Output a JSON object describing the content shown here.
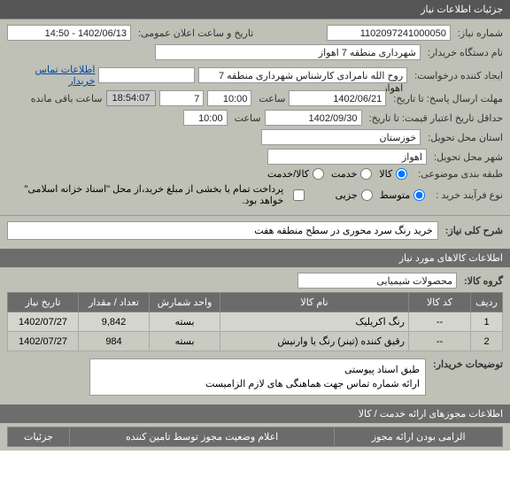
{
  "header": {
    "title": "جزئیات اطلاعات نیاز"
  },
  "fields": {
    "req_no_label": "شماره نیاز:",
    "req_no": "1102097241000050",
    "date_public_label": "تاریخ و ساعت اعلان عمومی:",
    "date_public": "1402/06/13 - 14:50",
    "buyer_org_label": "نام دستگاه خریدار:",
    "buyer_org": "شهرداری منطقه 7 اهواز",
    "requester_label": "ایجاد کننده درخواست:",
    "requester": "روح الله نامرادی کارشناس شهرداری منطقه 7 اهواز",
    "contact_link": "اطلاعات تماس خریدار",
    "deadline_reply_label": "مهلت ارسال پاسخ: تا تاریخ:",
    "deadline_reply_date": "1402/06/21",
    "time_label": "ساعت",
    "deadline_reply_time": "10:00",
    "days_field": "7",
    "countdown": "18:54:07",
    "countdown_label": "ساعت باقی مانده",
    "validity_label": "حداقل تاریخ اعتبار قیمت: تا تاریخ:",
    "validity_date": "1402/09/30",
    "validity_time": "10:00",
    "province_label": "استان محل تحویل:",
    "province": "خوزستان",
    "city_label": "شهر محل تحویل:",
    "city": "اهواز",
    "category_label": "طبقه بندی موضوعی:",
    "cat_kala": "کالا",
    "cat_khadamat": "خدمت",
    "cat_kalakhadamat": "کالا/خدمت",
    "process_label": "نوع فرآیند خرید :",
    "proc_mid": "متوسط",
    "proc_partial": "جزیی",
    "pay_note": "پرداخت تمام یا بخشی از مبلغ خرید،از محل \"اسناد خزانه اسلامی\" خواهد بود."
  },
  "desc": {
    "label": "شرح کلی نیاز:",
    "text": "خرید رنگ سرد محوری در سطح منطقه هفت"
  },
  "items_header": "اطلاعات کالاهای مورد نیاز",
  "group": {
    "label": "گروه کالا:",
    "value": "محصولات شیمیایی"
  },
  "table": {
    "cols": [
      "ردیف",
      "کد کالا",
      "نام کالا",
      "واحد شمارش",
      "تعداد / مقدار",
      "تاریخ نیاز"
    ],
    "rows": [
      {
        "idx": "1",
        "code": "--",
        "name": "رنگ اکریلیک",
        "unit": "بسته",
        "qty": "9,842",
        "date": "1402/07/27"
      },
      {
        "idx": "2",
        "code": "--",
        "name": "رقیق کننده (تینر) رنگ یا وارنیش",
        "unit": "بسته",
        "qty": "984",
        "date": "1402/07/27"
      }
    ]
  },
  "notes": {
    "label": "توضیحات خریدار:",
    "line1": "طبق اسناد پیوستی",
    "line2": "ارائه شماره تماس جهت هماهنگی های لازم الزامیست"
  },
  "footer": {
    "permits_header": "اطلاعات مجوزهای ارائه خدمت / کالا",
    "col_mandatory": "الزامی بودن ارائه مجوز",
    "col_status": "اعلام وضعیت مجوز توسط تامین کننده",
    "col_details": "جزئیات"
  }
}
